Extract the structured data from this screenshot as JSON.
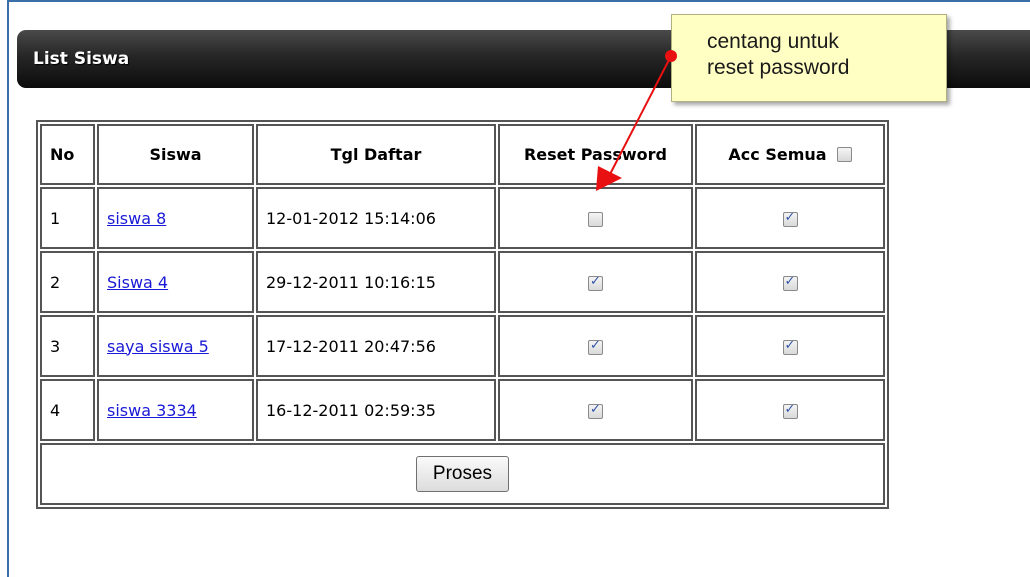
{
  "panel": {
    "title": "List Siswa"
  },
  "table": {
    "headers": {
      "no": "No",
      "siswa": "Siswa",
      "tgl": "Tgl Daftar",
      "reset": "Reset Password",
      "acc": "Acc Semua"
    },
    "acc_all_checked": false,
    "rows": [
      {
        "no": "1",
        "siswa": "siswa 8",
        "tgl": "12-01-2012 15:14:06",
        "reset": false,
        "acc": true
      },
      {
        "no": "2",
        "siswa": "Siswa 4",
        "tgl": "29-12-2011 10:16:15",
        "reset": true,
        "acc": true
      },
      {
        "no": "3",
        "siswa": "saya siswa 5",
        "tgl": "17-12-2011 20:47:56",
        "reset": true,
        "acc": true
      },
      {
        "no": "4",
        "siswa": "siswa 3334",
        "tgl": "16-12-2011 02:59:35",
        "reset": true,
        "acc": true
      }
    ],
    "submit_label": "Proses"
  },
  "callout": {
    "text": "centang untuk\nreset password"
  },
  "colors": {
    "arrow": "#e81010",
    "link": "#1a1ad6",
    "callout_bg": "#ffffc4"
  }
}
